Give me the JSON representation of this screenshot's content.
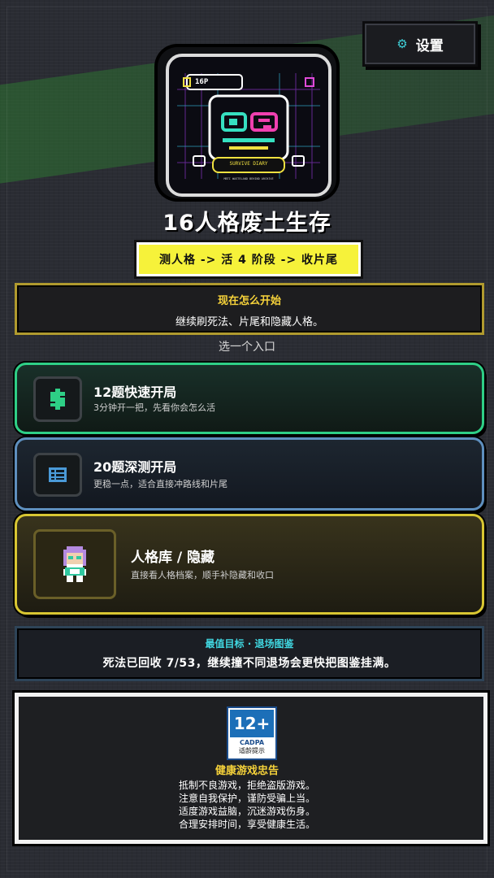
{
  "settings": {
    "icon": "gear-icon",
    "label": "设置"
  },
  "logo": {
    "badge": "16P",
    "banner": "SURVIVE DIARY",
    "small": "MBTI WASTELAND BEHIND ARCHIVE"
  },
  "title": "16人格废土生存",
  "subtitle": "测人格 -> 活 4 阶段 -> 收片尾",
  "notice": {
    "title": "现在怎么开始",
    "body": "继续刷死法、片尾和隐藏人格。"
  },
  "section_label": "选一个入口",
  "entries": [
    {
      "icon": "dollar-icon",
      "name": "12题快速开局",
      "desc": "3分钟开一把，先看你会怎么活",
      "accent": "#2ecf86"
    },
    {
      "icon": "list-icon",
      "name": "20题深测开局",
      "desc": "更稳一点，适合直接冲路线和片尾",
      "accent": "#5e8fbe"
    },
    {
      "icon": "pixel-character-icon",
      "name": "人格库 / 隐藏",
      "desc": "直接看人格档案，顺手补隐藏和收口",
      "accent": "#d8c632"
    }
  ],
  "goal": {
    "title": "最值目标 · 退场图鉴",
    "body": "死法已回收 7/53，继续撞不同退场会更快把图鉴挂满。"
  },
  "age_badge": {
    "rating": "12+",
    "org": "CADPA",
    "note": "适龄提示"
  },
  "health": {
    "title": "健康游戏忠告",
    "lines": [
      "抵制不良游戏，拒绝盗版游戏。",
      "注意自我保护，谨防受骗上当。",
      "适度游戏益脑，沉迷游戏伤身。",
      "合理安排时间，享受健康生活。"
    ]
  }
}
